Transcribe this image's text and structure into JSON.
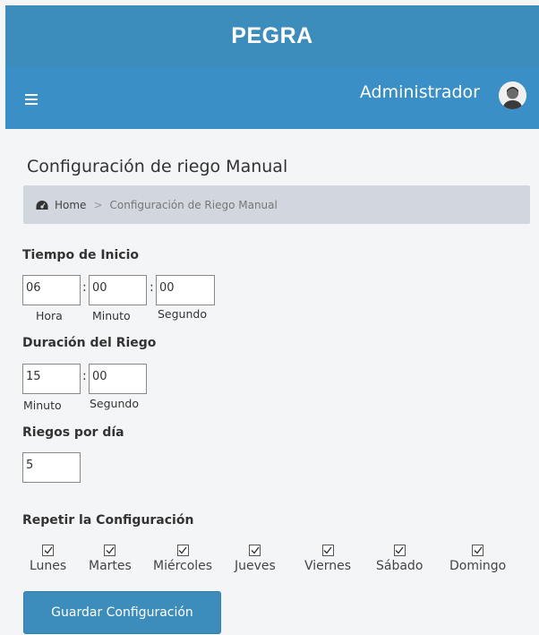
{
  "app": {
    "title": "PEGRA"
  },
  "navbar": {
    "user_name": "Administrador"
  },
  "page": {
    "title": "Configuración de riego Manual"
  },
  "breadcrumb": {
    "home": "Home",
    "separator": ">",
    "current": "Configuración de Riego Manual"
  },
  "start_time": {
    "label": "Tiempo de Inicio",
    "hour": "06",
    "minute": "00",
    "second": "00",
    "hour_label": "Hora",
    "minute_label": "Minuto",
    "second_label": "Segundo"
  },
  "duration": {
    "label": "Duración del Riego",
    "minute": "15",
    "second": "00",
    "minute_label": "Minuto",
    "second_label": "Segundo"
  },
  "per_day": {
    "label": "Riegos por día",
    "value": "5"
  },
  "repeat": {
    "label": "Repetir la Configuración",
    "days": [
      "Lunes",
      "Martes",
      "Miércoles",
      "Jueves",
      "Viernes",
      "Sábado",
      "Domingo"
    ],
    "checked": [
      true,
      true,
      true,
      true,
      true,
      true,
      true
    ]
  },
  "colon": ":",
  "save_button": "Guardar Configuración",
  "colors": {
    "primary": "#3c8dbc",
    "breadcrumb_bg": "#d2d6de",
    "page_bg": "#f4f5f7"
  },
  "icons": {
    "menu": "hamburger-icon",
    "home": "dashboard-icon",
    "checkbox": "check-icon"
  }
}
